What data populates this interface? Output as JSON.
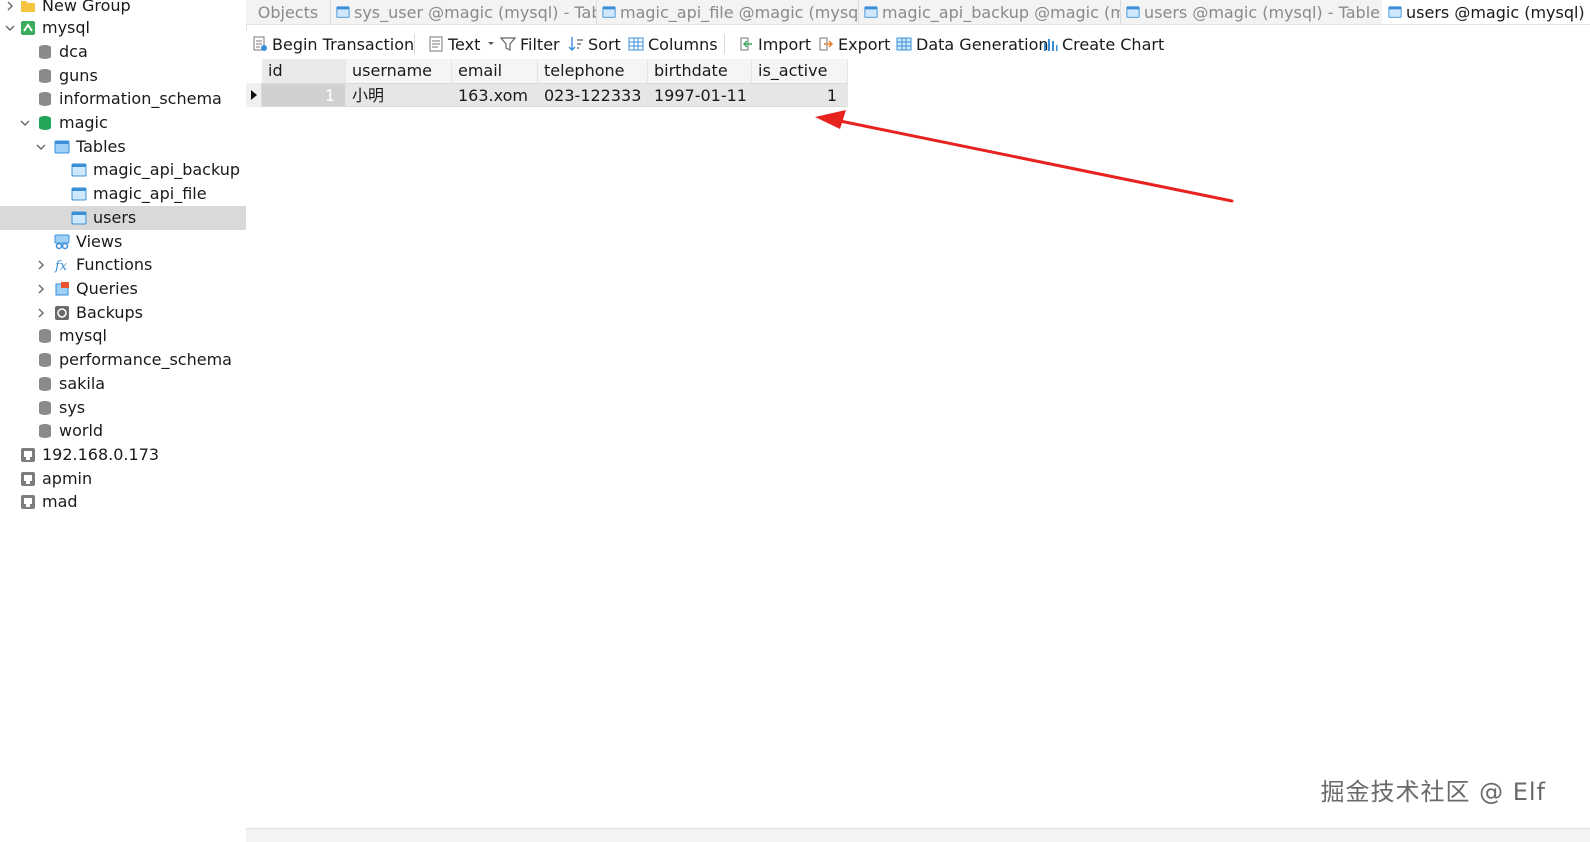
{
  "sidebar": {
    "items": [
      {
        "label": "New Group",
        "level": 1,
        "chevron": "right",
        "icon": "folder-icon"
      },
      {
        "label": "mysql",
        "level": 1,
        "chevron": "down",
        "icon": "connection-icon"
      },
      {
        "label": "dca",
        "level": 2,
        "icon": "database-icon"
      },
      {
        "label": "guns",
        "level": 2,
        "icon": "database-icon"
      },
      {
        "label": "information_schema",
        "level": 2,
        "icon": "database-icon"
      },
      {
        "label": "magic",
        "level": 2,
        "chevron": "down",
        "icon": "database-open-icon"
      },
      {
        "label": "Tables",
        "level": 3,
        "chevron": "down",
        "icon": "tables-icon"
      },
      {
        "label": "magic_api_backup",
        "level": 4,
        "icon": "table-icon"
      },
      {
        "label": "magic_api_file",
        "level": 4,
        "icon": "table-icon"
      },
      {
        "label": "users",
        "level": 4,
        "icon": "table-icon",
        "selected": true
      },
      {
        "label": "Views",
        "level": 3,
        "icon": "views-icon"
      },
      {
        "label": "Functions",
        "level": 3,
        "chevron": "right",
        "icon": "function-icon"
      },
      {
        "label": "Queries",
        "level": 3,
        "chevron": "right",
        "icon": "queries-icon"
      },
      {
        "label": "Backups",
        "level": 3,
        "chevron": "right",
        "icon": "backups-icon"
      },
      {
        "label": "mysql",
        "level": 2,
        "icon": "database-icon"
      },
      {
        "label": "performance_schema",
        "level": 2,
        "icon": "database-icon"
      },
      {
        "label": "sakila",
        "level": 2,
        "icon": "database-icon"
      },
      {
        "label": "sys",
        "level": 2,
        "icon": "database-icon"
      },
      {
        "label": "world",
        "level": 2,
        "icon": "database-icon"
      },
      {
        "label": "192.168.0.173",
        "level": 1,
        "icon": "server-icon"
      },
      {
        "label": "apmin",
        "level": 1,
        "icon": "server-icon"
      },
      {
        "label": "mad",
        "level": 1,
        "icon": "server-icon"
      }
    ]
  },
  "tabs": [
    {
      "label": "Objects"
    },
    {
      "label": "sys_user @magic (mysql) - Table"
    },
    {
      "label": "magic_api_file @magic (mysql)..."
    },
    {
      "label": "magic_api_backup @magic (m..."
    },
    {
      "label": "users @magic (mysql) - Table"
    },
    {
      "label": "users @magic (mysql) - Table",
      "active": true
    }
  ],
  "toolbar": {
    "begin_transaction": "Begin Transaction",
    "text": "Text",
    "filter": "Filter",
    "sort": "Sort",
    "columns": "Columns",
    "import": "Import",
    "export": "Export",
    "data_generation": "Data Generation",
    "create_chart": "Create Chart"
  },
  "grid": {
    "columns": [
      "id",
      "username",
      "email",
      "telephone",
      "birthdate",
      "is_active"
    ],
    "rows": [
      [
        "1",
        "小明",
        "163.xom",
        "023-122333",
        "1997-01-11",
        "1"
      ]
    ]
  },
  "watermark": "掘金技术社区 @ Elf",
  "colors": {
    "accent_blue": "#3b8fd9",
    "selected_row": "#d9d9d9",
    "arrow_red": "#e8231f",
    "connection_green": "#3cab5a"
  }
}
